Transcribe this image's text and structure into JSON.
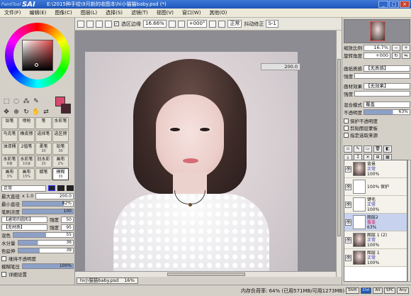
{
  "app": {
    "logo_small": "PaintTool",
    "logo_big": "SAI",
    "title": "E:\\2015种手绘\\9月新的收图本\\hi小猫猫baby.psd (*)"
  },
  "menu": [
    "文件(F)",
    "编辑(E)",
    "图像(C)",
    "图层(L)",
    "选择(S)",
    "滤镜(T)",
    "视图(V)",
    "窗口(W)",
    "其他(O)"
  ],
  "toolbar": {
    "selection_edge_label": "选区边缘",
    "zoom": "16.66%",
    "rotate": "+000°",
    "blend": "正常",
    "stabilizer_label": "抖动修正",
    "stabilizer": "S-1"
  },
  "canvas": {
    "overlay_value": "200.0"
  },
  "brushes": [
    {
      "name": "铅笔",
      "size": ""
    },
    {
      "name": "喷枪",
      "size": ""
    },
    {
      "name": "笔",
      "size": ""
    },
    {
      "name": "水彩笔",
      "size": ""
    },
    {
      "name": "马克笔",
      "size": ""
    },
    {
      "name": "橡皮擦",
      "size": ""
    },
    {
      "name": "选择笔",
      "size": ""
    },
    {
      "name": "选区擦",
      "size": ""
    },
    {
      "name": "油漆桶",
      "size": ""
    },
    {
      "name": "2值笔",
      "size": ""
    },
    {
      "name": "柔笔",
      "size": "30"
    },
    {
      "name": "铅笔",
      "size": "30"
    },
    {
      "name": "水彩笔",
      "size": "9液"
    },
    {
      "name": "水彩笔",
      "size": "10涂"
    },
    {
      "name": "旧水彩",
      "size": "20"
    },
    {
      "name": "画布",
      "size": "2%"
    },
    {
      "name": "画布",
      "size": "3%"
    },
    {
      "name": "画布",
      "size": "15%"
    },
    {
      "name": "蜡笔",
      "size": ""
    },
    {
      "name": "模糊",
      "size": "30"
    }
  ],
  "brush_settings": {
    "mode": "正常",
    "max_size_label": "最大直径",
    "max_size_mult": "x 1.0",
    "max_size": "200.0",
    "min_size_label": "最小直径",
    "min_size": "82%",
    "density_label": "笔刷浓度",
    "density": "100",
    "shape": "【通常的圆形】",
    "shape_strength_label": "强度",
    "shape_strength": "50",
    "texture": "【无材质】",
    "texture_strength_label": "强度",
    "texture_strength": "95",
    "blend_label": "混色",
    "blend": "55",
    "dilution_label": "水分量",
    "dilution": "36",
    "persistence_label": "色延伸",
    "persistence": "39",
    "keep_opacity_label": "维持不透明度",
    "blur_label": "模糊笔压",
    "blur": "100%",
    "detail_label": "详细设置"
  },
  "navigator": {
    "zoom_label": "缩放比例",
    "zoom": "16.7%",
    "angle_label": "旋转角度",
    "angle": "+000"
  },
  "layer_panel": {
    "paper_texture_label": "画纸质感",
    "paper_texture": "【无质感】",
    "paper_effect_label": "画材效果",
    "paper_effect": "【无效果】",
    "strength_label": "强度",
    "blend_mode_label": "混合模式",
    "blend_mode": "覆盖",
    "opacity_label": "不透明度",
    "opacity": "63%",
    "protect_opacity": "保护不透明度",
    "clip_group": "剪贴图层蒙板",
    "selection_source": "指定选取来源"
  },
  "layers": [
    {
      "name": "背景",
      "mode": "正常",
      "opacity": "100%",
      "thumb": "photo",
      "selected": false
    },
    {
      "name": "",
      "mode": "",
      "opacity": "100% 保护",
      "thumb": "blank",
      "selected": false
    },
    {
      "name": "键毛",
      "mode": "正常",
      "opacity": "100%",
      "thumb": "blank",
      "selected": false
    },
    {
      "name": "图层2",
      "mode": "覆盖",
      "opacity": "63%",
      "thumb": "blank",
      "selected": true
    },
    {
      "name": "图层 1 (2)",
      "mode": "正常",
      "opacity": "100%",
      "thumb": "photo",
      "selected": false
    },
    {
      "name": "图层 1",
      "mode": "正常",
      "opacity": "100%",
      "thumb": "photo",
      "selected": false
    }
  ],
  "doc_tab": {
    "name": "hi小猫猫baby.psd",
    "zoom": "16%"
  },
  "status": {
    "memory": "内存负荷率: 64% (已用571MB/可用1273MB)",
    "keys": [
      "Shift",
      "Ctrl",
      "Alt",
      "SPC",
      "Any"
    ]
  },
  "colors": {
    "primary": "#d64a6c",
    "secondary": "#4a2530",
    "title_bar": "#1f57b8"
  }
}
